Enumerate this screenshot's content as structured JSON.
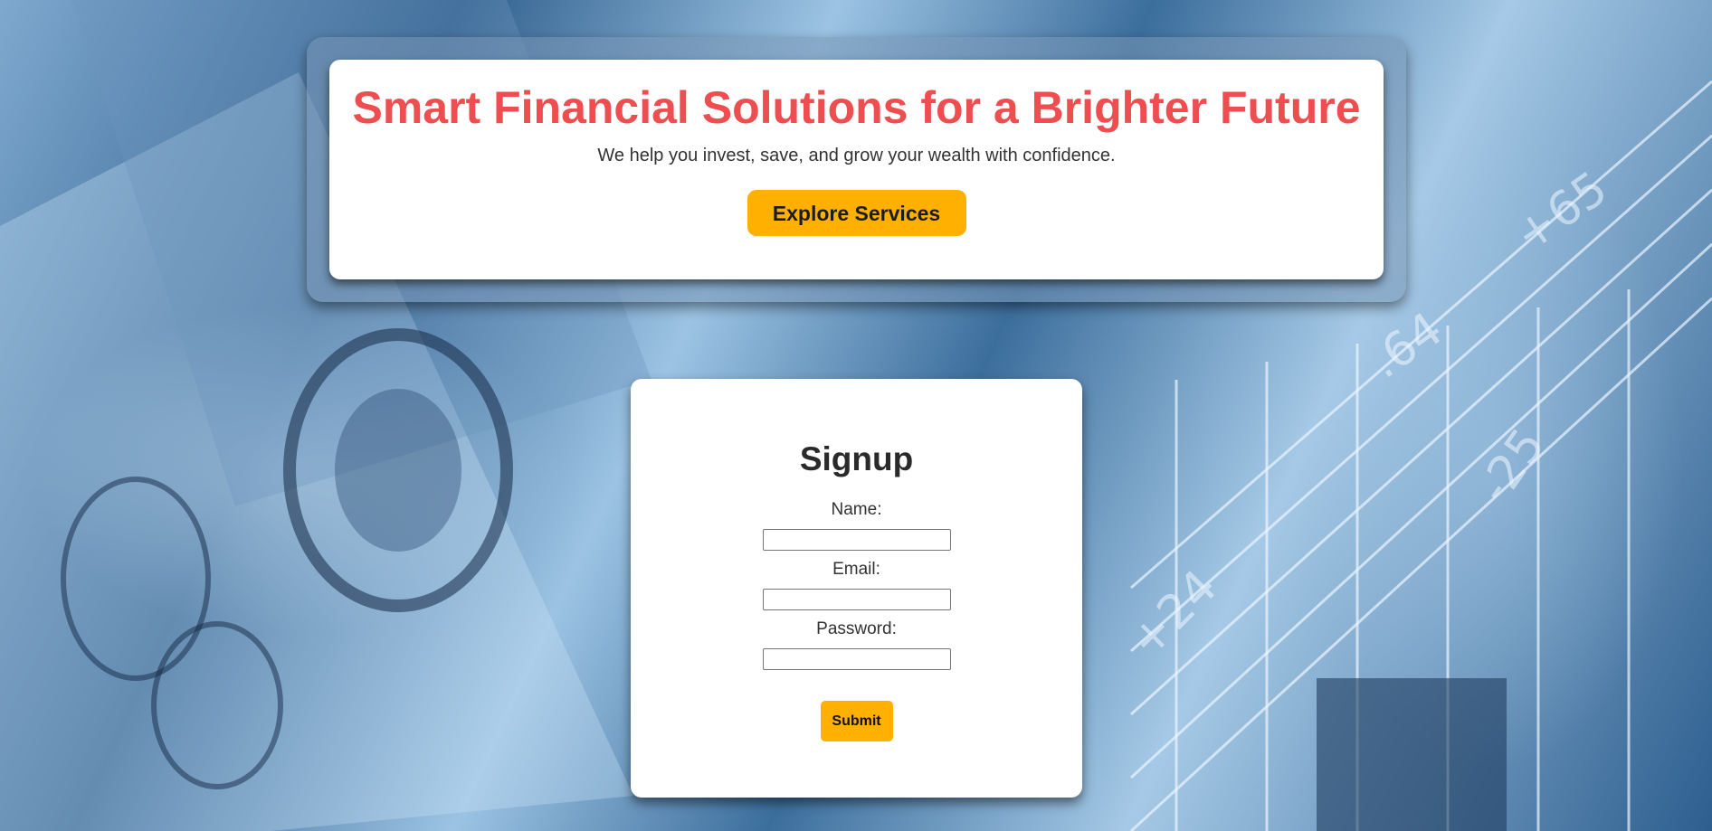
{
  "hero": {
    "title": "Smart Financial Solutions for a Brighter Future",
    "subtitle": "We help you invest, save, and grow your wealth with confidence.",
    "cta_label": "Explore Services"
  },
  "signup": {
    "title": "Signup",
    "fields": [
      {
        "label": "Name:",
        "value": ""
      },
      {
        "label": "Email:",
        "value": ""
      },
      {
        "label": "Password:",
        "value": ""
      }
    ],
    "submit_label": "Submit"
  },
  "colors": {
    "title": "#ee4e50",
    "accent": "#ffb000",
    "background": "#3c6e9c"
  }
}
